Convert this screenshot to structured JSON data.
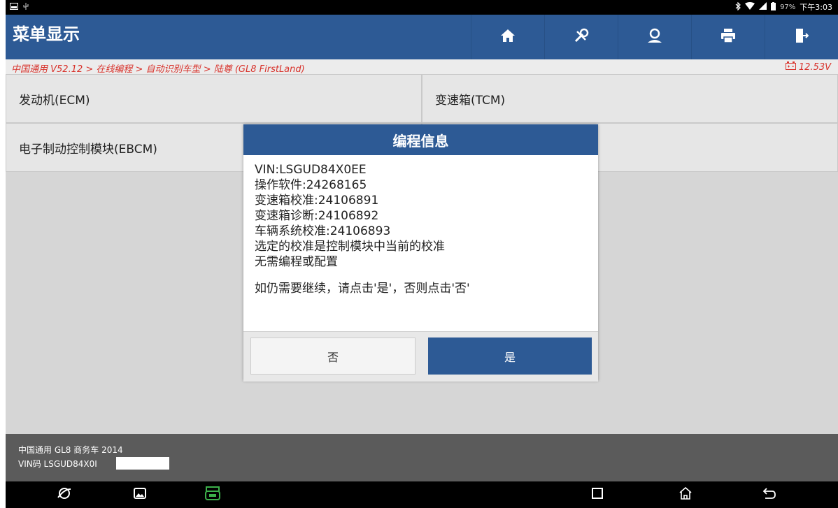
{
  "status": {
    "battery_pct": "97%",
    "time": "下午3:03"
  },
  "header": {
    "title": "菜单显示",
    "icons": [
      "home-icon",
      "tools-icon",
      "user-icon",
      "printer-icon",
      "exit-icon"
    ]
  },
  "breadcrumb": {
    "path": "中国通用 V52.12 > 在线编程 > 自动识别车型 > 陆尊 (GL8 FirstLand)",
    "voltage": "12.53V"
  },
  "modules": [
    {
      "label": "发动机(ECM)"
    },
    {
      "label": "变速箱(TCM)"
    },
    {
      "label": "电子制动控制模块(EBCM)"
    },
    {
      "label": ""
    }
  ],
  "dialog": {
    "title": "编程信息",
    "lines": [
      "VIN:LSGUD84X0EE",
      "操作软件:24268165",
      "变速箱校准:24106891",
      "变速箱诊断:24106892",
      "车辆系统校准:24106893",
      "选定的校准是控制模块中当前的校准",
      "无需编程或配置"
    ],
    "prompt": "如仍需要继续，请点击'是'，否则点击'否'",
    "no_label": "否",
    "yes_label": "是"
  },
  "footer": {
    "vehicle": "中国通用 GL8 商务车 2014",
    "vin": "VIN码 LSGUD84X0I"
  },
  "colors": {
    "accent": "#2d5a95",
    "breadcrumb_text": "#d8322b",
    "vci_green": "#3cb04a"
  }
}
